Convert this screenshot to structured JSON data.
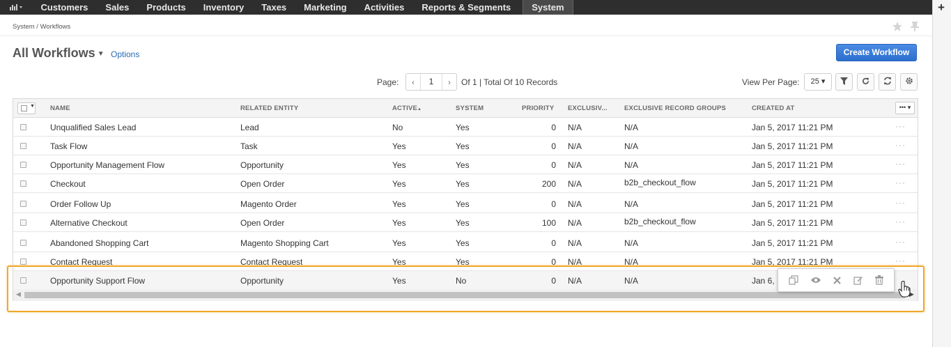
{
  "nav": {
    "items": [
      "Customers",
      "Sales",
      "Products",
      "Inventory",
      "Taxes",
      "Marketing",
      "Activities",
      "Reports & Segments",
      "System"
    ],
    "active": "System"
  },
  "breadcrumb": "System / Workflows",
  "page": {
    "title": "All Workflows",
    "options_label": "Options",
    "create_label": "Create Workflow"
  },
  "pager": {
    "page_label": "Page:",
    "page_value": "1",
    "total_text": "Of 1 | Total Of 10 Records",
    "view_per_page_label": "View Per Page:",
    "per_page": "25"
  },
  "grid": {
    "columns": [
      "NAME",
      "RELATED ENTITY",
      "ACTIVE",
      "SYSTEM",
      "PRIORITY",
      "EXCLUSIV...",
      "EXCLUSIVE RECORD GROUPS",
      "CREATED AT"
    ],
    "rows": [
      [
        "Unqualified Sales Lead",
        "Lead",
        "No",
        "Yes",
        "0",
        "N/A",
        "N/A",
        "Jan 5, 2017 11:21 PM"
      ],
      [
        "Task Flow",
        "Task",
        "Yes",
        "Yes",
        "0",
        "N/A",
        "N/A",
        "Jan 5, 2017 11:21 PM"
      ],
      [
        "Opportunity Management Flow",
        "Opportunity",
        "Yes",
        "Yes",
        "0",
        "N/A",
        "N/A",
        "Jan 5, 2017 11:21 PM"
      ],
      [
        "Checkout",
        "Open Order",
        "Yes",
        "Yes",
        "200",
        "N/A",
        "b2b_checkout_flow",
        "Jan 5, 2017 11:21 PM"
      ],
      [
        "Order Follow Up",
        "Magento Order",
        "Yes",
        "Yes",
        "0",
        "N/A",
        "N/A",
        "Jan 5, 2017 11:21 PM"
      ],
      [
        "Alternative Checkout",
        "Open Order",
        "Yes",
        "Yes",
        "100",
        "N/A",
        "b2b_checkout_flow",
        "Jan 5, 2017 11:21 PM"
      ],
      [
        "Abandoned Shopping Cart",
        "Magento Shopping Cart",
        "Yes",
        "Yes",
        "0",
        "N/A",
        "N/A",
        "Jan 5, 2017 11:21 PM"
      ],
      [
        "Contact Request",
        "Contact Request",
        "Yes",
        "Yes",
        "0",
        "N/A",
        "N/A",
        "Jan 5, 2017 11:21 PM"
      ],
      [
        "Opportunity Support Flow",
        "Opportunity",
        "Yes",
        "No",
        "0",
        "N/A",
        "N/A",
        "Jan 6,"
      ]
    ]
  },
  "row_actions": [
    "clone-icon",
    "view-icon",
    "deactivate-icon",
    "edit-icon",
    "delete-icon"
  ],
  "colors": {
    "nav_bg": "#2e2e2e",
    "primary": "#2b6fcf",
    "highlight": "#f0a82a",
    "link": "#2a6ab2"
  }
}
